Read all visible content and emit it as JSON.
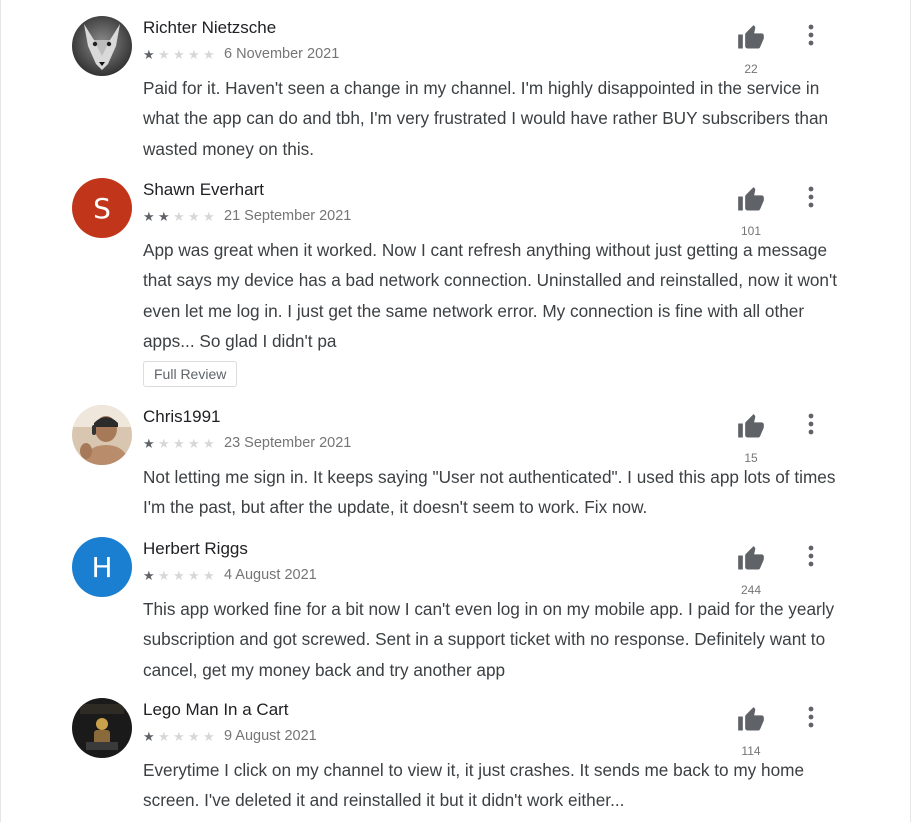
{
  "reviews": [
    {
      "name": "Richter Nietzsche",
      "stars": 1,
      "date": "6 November 2021",
      "likes": "22",
      "text": "Paid for it. Haven't seen a change in my channel. I'm highly disappointed in the service in what the app can do and tbh, I'm very frustrated I would have rather BUY subscribers than wasted money on this."
    },
    {
      "name": "Shawn Everhart",
      "avatar_letter": "S",
      "avatar_color": "#c1361b",
      "stars": 2,
      "date": "21 September 2021",
      "likes": "101",
      "text": "App was great when it worked. Now I cant refresh anything without just getting a message that says my device has a bad network connection. Uninstalled and reinstalled, now it won't even let me log in. I just get the same network error. My connection is fine with all other apps... So glad I didn't pa",
      "full_review_label": "Full Review"
    },
    {
      "name": "Chris1991",
      "stars": 1,
      "date": "23 September 2021",
      "likes": "15",
      "text": "Not letting me sign in. It keeps saying \"User not authenticated\". I used this app lots of times I'm the past, but after the update, it doesn't seem to work. Fix now."
    },
    {
      "name": "Herbert Riggs",
      "avatar_letter": "H",
      "avatar_color": "#1a7fd1",
      "stars": 1,
      "date": "4 August 2021",
      "likes": "244",
      "text": "This app worked fine for a bit now I can't even log in on my mobile app. I paid for the yearly subscription and got screwed. Sent in a support ticket with no response. Definitely want to cancel, get my money back and try another app"
    },
    {
      "name": "Lego Man In a Cart",
      "stars": 1,
      "date": "9 August 2021",
      "likes": "114",
      "text": "Everytime I click on my channel to view it, it just crashes. It sends me back to my home screen. I've deleted it and reinstalled it but it didn't work either..."
    }
  ],
  "icons": {
    "like": "thumb-up-icon",
    "more": "more-vert-icon",
    "star": "star-icon"
  },
  "colors": {
    "star_filled": "#5f6368",
    "star_empty": "#d7d7d7",
    "icon": "#5f6368"
  }
}
